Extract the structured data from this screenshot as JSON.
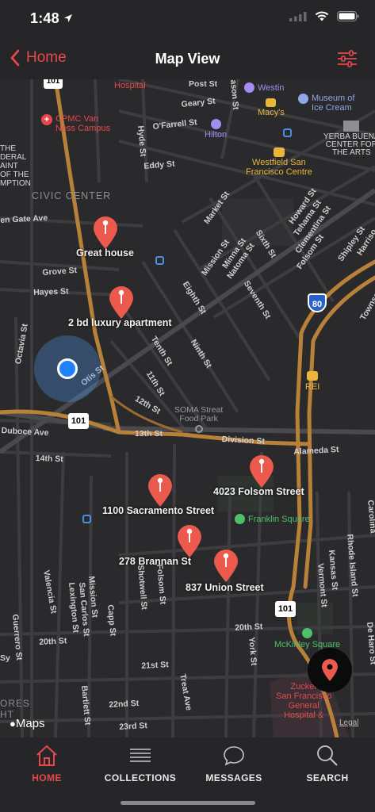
{
  "status_bar": {
    "time": "1:48"
  },
  "nav": {
    "back_label": "Home",
    "title": "Map View"
  },
  "map": {
    "district": "CIVIC CENTER",
    "streets": {
      "post": "Post St",
      "geary": "Geary St",
      "ofarrell": "O'Farrell St",
      "eddy": "Eddy St",
      "golden_gate": "en Gate Ave",
      "grove": "Grove St",
      "hayes": "Hayes St",
      "octavia": "Octavia St",
      "otis": "Otis St",
      "duboce": "Duboce Ave",
      "fourteenth": "14th St",
      "market": "Market St",
      "mission": "Mission St",
      "minna": "Minna St",
      "natoma": "Natoma St",
      "howard": "Howard St",
      "tehama": "Tehama St",
      "clementina": "Clementina St",
      "folsom_top": "Folsom St",
      "shipley": "Shipley St",
      "sixth": "Sixth St",
      "seventh": "Seventh St",
      "eighth": "Eighth St",
      "ninth": "Ninth St",
      "tenth": "Tenth St",
      "eleventh": "11th St",
      "twelfth": "12th St",
      "thirteenth": "13th St",
      "division": "Division St",
      "alameda": "Alameda St",
      "harrison": "Harriso",
      "valencia": "Valencia St",
      "guerrero": "Guerrero St",
      "mission_low": "Mission St",
      "san_carlos": "San Carlos St",
      "lexington": "Lexington St",
      "capp": "Capp St",
      "shotwell": "Shotwell St",
      "folsom_low": "Folsom St",
      "vermont": "Vermont St",
      "kansas": "Kansas St",
      "rhode_island": "Rhode Island St",
      "carolina": "Carolina",
      "de_haro": "De Haro St",
      "twentieth": "20th St",
      "twentieth_b": "20th St",
      "york": "York St",
      "twentyfirst": "21st St",
      "twentysecond": "22nd St",
      "twentythird": "23rd St",
      "treat": "Treat Ave",
      "bartlett": "Bartlett St",
      "hyde": "Hyde St",
      "mason": "ason St",
      "townsend": "Townse",
      "sy": "Sy",
      "highway_101": "101",
      "highway_80": "80"
    },
    "pois": {
      "hospital": "Hospital",
      "cpmc": "CPMC Van\nNess Campus",
      "westin": "Westin",
      "macys": "Macy's",
      "museum": "Museum of\nIce Cream",
      "hilton": "Hilton",
      "westfield": "Westfield San\nFrancisco Centre",
      "yerba": "YERBA BUENA\nCENTER FOR\nTHE ARTS",
      "federal": "THE\nDERAL\nAINT\nOF THE\nMPTION",
      "rei": "REI",
      "soma": "SOMA Streat\nFood Park",
      "franklin": "Franklin Square",
      "mckinley": "McKinley Square",
      "zuckerberg": "Zucker\nSan Francisco\nGeneral\nHospital &",
      "stores": "ORES\nHT"
    },
    "pins": [
      {
        "label": "Great house"
      },
      {
        "label": "2 bd luxury apartment"
      },
      {
        "label": "4023 Folsom Street"
      },
      {
        "label": "1100 Sacramento Street"
      },
      {
        "label": "278 Brannan St"
      },
      {
        "label": "837 Union Street"
      }
    ],
    "attribution": "Maps",
    "legal": "Legal"
  },
  "tabs": [
    {
      "label": "HOME",
      "icon": "home-icon",
      "active": true
    },
    {
      "label": "COLLECTIONS",
      "icon": "collections-icon",
      "active": false
    },
    {
      "label": "MESSAGES",
      "icon": "messages-icon",
      "active": false
    },
    {
      "label": "SEARCH",
      "icon": "search-icon",
      "active": false
    }
  ],
  "colors": {
    "accent": "#e9484b",
    "highway": "#b8813a",
    "map_bg": "#2a2a2c",
    "bar_bg": "#262628"
  }
}
